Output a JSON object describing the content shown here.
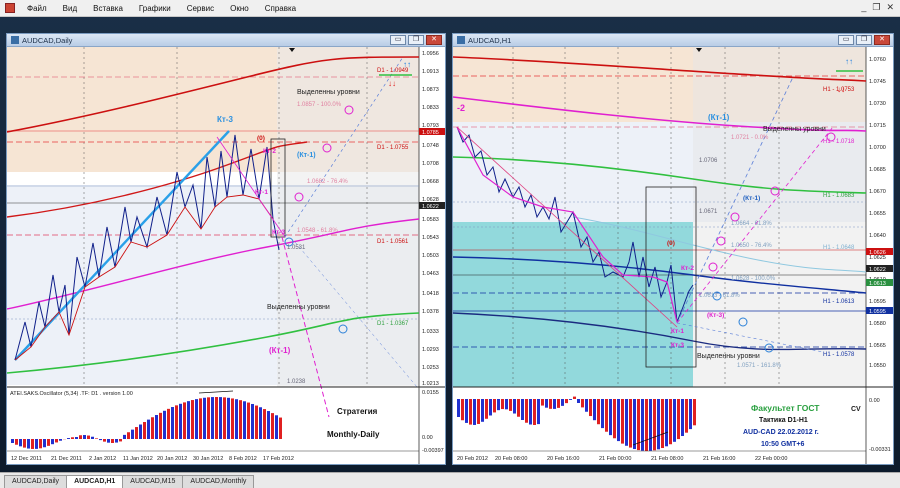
{
  "menubar": {
    "items": [
      "Файл",
      "Вид",
      "Вставка",
      "Графики",
      "Сервис",
      "Окно",
      "Справка"
    ]
  },
  "left": {
    "title": "AUDCAD,Daily",
    "price_ticks": [
      "1.0956",
      "1.0913",
      "1.0873",
      "1.0833",
      "1.0793",
      "1.0748",
      "1.0708",
      "1.0668",
      "1.0628",
      "1.0583",
      "1.0543",
      "1.0503",
      "1.0463",
      "1.0418",
      "1.0378",
      "1.0333",
      "1.0293",
      "1.0253",
      "1.0213"
    ],
    "current_price_tag": "1.0622",
    "red_price_tag": "1.0785",
    "date_ticks": [
      "12 Dec 2011",
      "21 Dec 2011",
      "2 Jan 2012",
      "11 Jan 2012",
      "20 Jan 2012",
      "30 Jan 2012",
      "8 Feb 2012",
      "17 Feb 2012"
    ],
    "labels": {
      "kt3": "Кт-3",
      "zero": "(0)",
      "kt2": "Кт-2",
      "kt1": "Кт-1",
      "kt1p": "(Кт-1)",
      "kt3b": "Кт-3",
      "kt1p2": "(Кт-1)",
      "sel_top": "Выделенны уровни",
      "sel_bot": "Выделенны уровни",
      "d1_top": "D1 - 1.0949",
      "d1_mid": "D1 - 1.0755",
      "d1_low": "D1 - 1.0561",
      "d1_green": "D1 - 1.0367",
      "fib_top": "1.0857 - 100.0%",
      "fib_mid": "1.0682 - 76.4%",
      "fib_low": "1.0548 - 61.8%",
      "lvl_0531": "1.0531",
      "lvl_0238": "1.0238"
    },
    "osc": {
      "title": "ATEI.SAKS.Oscillator (5,34) .TF: D1 . version 1.00",
      "ticks": [
        "0.0155",
        "0.00",
        "-0.00397"
      ],
      "strategy_line1": "Стратегия",
      "strategy_line2": "Monthly-Daily"
    }
  },
  "right": {
    "title": "AUDCAD,H1",
    "price_ticks": [
      "1.0760",
      "1.0745",
      "1.0730",
      "1.0715",
      "1.0700",
      "1.0685",
      "1.0670",
      "1.0655",
      "1.0640",
      "1.0625",
      "1.0610",
      "1.0595",
      "1.0580",
      "1.0565",
      "1.0550"
    ],
    "current_price_tag": "1.0622",
    "tags": [
      "1.0626",
      "1.0613",
      "1.0595"
    ],
    "date_ticks": [
      "20 Feb 2012",
      "20 Feb 08:00",
      "20 Feb 16:00",
      "21 Feb 00:00",
      "21 Feb 08:00",
      "21 Feb 16:00",
      "22 Feb 00:00"
    ],
    "labels": {
      "neg2": "-2",
      "kt1p": "(Кт-1)",
      "kt1p2": "(Кт-1)",
      "zero": "(0)",
      "kt2": "Кт-2",
      "kt3p": "(Кт-3)",
      "kt1": "Кт-1",
      "kt3": "Кт-3",
      "sel_top": "Выделенны уровни",
      "sel_bot": "Выделенны уровни",
      "h1_top": "H1 - 1.0753",
      "h1_718": "H1 - 1.0718",
      "h1_683": "H1 - 1.0683",
      "h1_648": "H1 - 1.0648",
      "h1_613": "H1 - 1.0613",
      "h1_578": "H1 - 1.0578",
      "fib_top": "1.0721 - 0.0%",
      "fib_706": "1.0706",
      "fib_671": "1.0671",
      "fib_664": "1.0664 - 61.8%",
      "fib_650": "1.0650 - 76.4%",
      "fib_628": "1.0628 - 100.0%",
      "fib_613": "1.0613 - 61.8%",
      "fib_571": "1.0571 - 161.8%"
    },
    "info": {
      "line1": "Факультет ГОСТ",
      "line2": "Тактика  D1-H1",
      "line3": "AUD-CAD 22.02.2012 г.",
      "line4": "10:50  GMT+6",
      "cv": "CV"
    },
    "osc": {
      "ticks": [
        "0.00",
        "-0.00331"
      ]
    }
  },
  "tabs": [
    "AUDCAD,Daily",
    "AUDCAD,H1",
    "AUDCAD,M15",
    "AUDCAD,Monthly"
  ],
  "colors": {
    "accent_blue": "#1e90ff",
    "magenta": "#e020d0",
    "red": "#cc1010",
    "green": "#30c040",
    "navy": "#10208a",
    "teal": "#7fd2d6"
  }
}
